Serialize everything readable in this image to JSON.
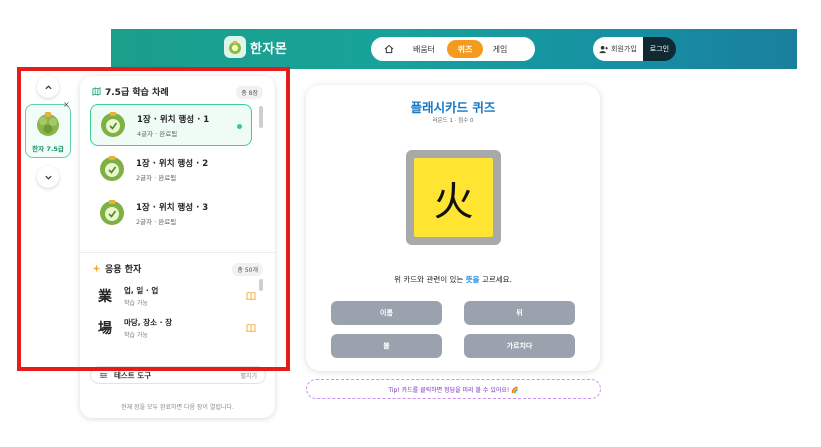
{
  "header": {
    "logo_text": "한자몬",
    "nav": {
      "home_icon": "home-icon",
      "learn": "배움터",
      "quiz": "퀴즈",
      "game": "게임"
    },
    "signup": "회원가입",
    "login": "로그인"
  },
  "rail": {
    "card_label": "한자 7.5급",
    "close": "×"
  },
  "lessons": {
    "title": "7.5급 학습 차례",
    "count": "총 8장",
    "items": [
      {
        "title": "1장 · 위치 행성 · 1",
        "sub": "4글자 · 완료됨"
      },
      {
        "title": "1장 · 위치 행성 · 2",
        "sub": "2글자 · 완료됨"
      },
      {
        "title": "1장 · 위치 행성 · 3",
        "sub": "2글자 · 완료됨"
      }
    ]
  },
  "hanja": {
    "title": "응용 한자",
    "count": "총 50개",
    "items": [
      {
        "char": "業",
        "title": "업, 일 · 업",
        "sub": "학습 가능"
      },
      {
        "char": "場",
        "title": "마당, 장소 · 장",
        "sub": "학습 가능"
      }
    ]
  },
  "tools": {
    "label": "테스트 도구",
    "action": "펼치기"
  },
  "footer_note": "현재 장을 모두 완료하면 다음 장이 열립니다.",
  "quiz": {
    "title": "플래시카드 퀴즈",
    "meta": "라운드 1 · 점수 0",
    "character": "火",
    "question_pre": "위 카드와 관련이 있는 ",
    "question_hl": "뜻을",
    "question_post": " 고르세요.",
    "options": [
      "이름",
      "뒤",
      "불",
      "가르치다"
    ]
  },
  "tip": "Tip! 카드를 클릭하면 정답을 미리 볼 수 있어요! 🌈"
}
